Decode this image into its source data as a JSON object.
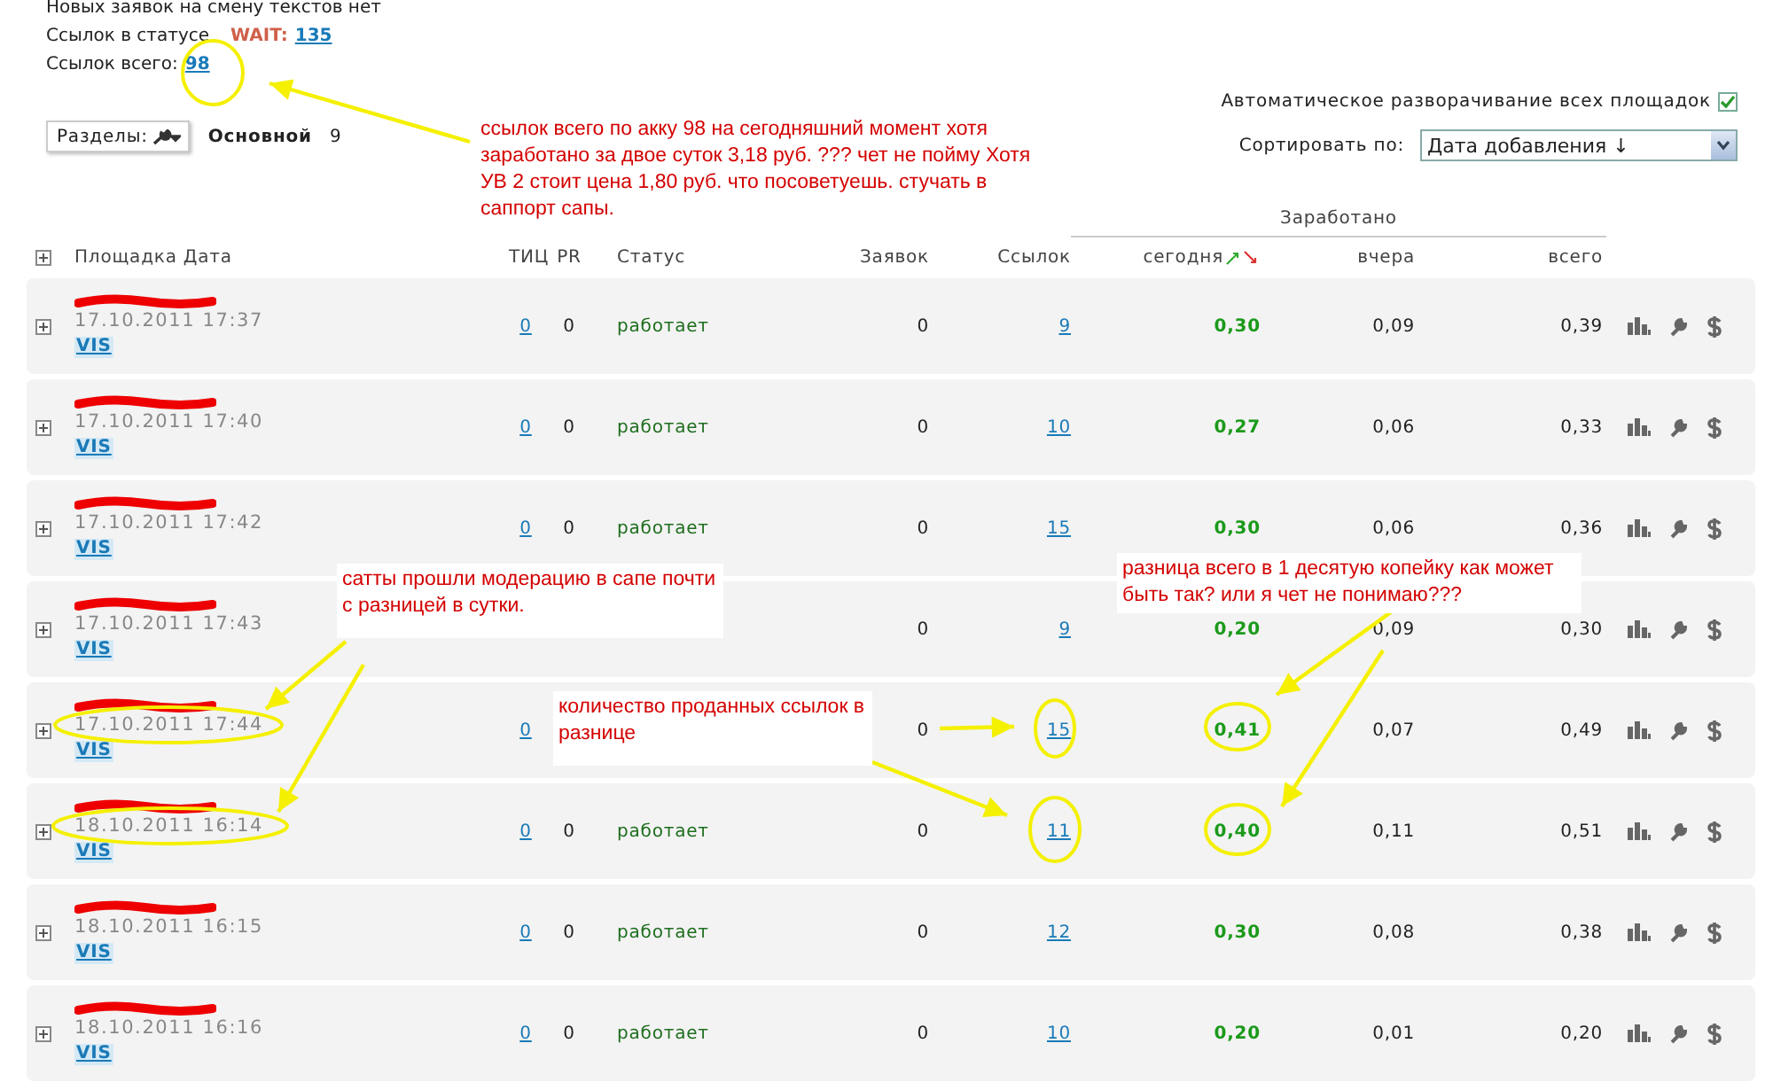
{
  "summary": {
    "no_requests_text": "Новых заявок на смену текстов нет",
    "wait_label": "Ссылок в статусе",
    "wait_status": "WAIT:",
    "wait_count": "135",
    "total_label": "Ссылок всего:",
    "total_count": "98"
  },
  "sections": {
    "label": "Разделы:",
    "current": "Основной",
    "count": "9"
  },
  "auto_expand": {
    "label": "Автоматическое разворачивание всех площадок",
    "checked": true
  },
  "sort": {
    "label": "Сортировать по:",
    "value": "Дата добавления ↓"
  },
  "table": {
    "group_header": "Заработано",
    "columns": [
      "Площадка Дата",
      "ТИЦ",
      "PR",
      "Статус",
      "Заявок",
      "Ссылок",
      "сегодня",
      "вчера",
      "всего"
    ],
    "rows": [
      {
        "date": "17.10.2011 17:37",
        "tag": "VIS",
        "tic": "0",
        "pr": "0",
        "status": "работает",
        "requests": "0",
        "links": "9",
        "today": "0,30",
        "yesterday": "0,09",
        "total": "0,39"
      },
      {
        "date": "17.10.2011 17:40",
        "tag": "VIS",
        "tic": "0",
        "pr": "0",
        "status": "работает",
        "requests": "0",
        "links": "10",
        "today": "0,27",
        "yesterday": "0,06",
        "total": "0,33"
      },
      {
        "date": "17.10.2011 17:42",
        "tag": "VIS",
        "tic": "0",
        "pr": "0",
        "status": "работает",
        "requests": "0",
        "links": "15",
        "today": "0,30",
        "yesterday": "0,06",
        "total": "0,36"
      },
      {
        "date": "17.10.2011 17:43",
        "tag": "VIS",
        "requests": "0",
        "links": "9",
        "today": "0,20",
        "yesterday": "0,09",
        "total": "0,30"
      },
      {
        "date": "17.10.2011 17:44",
        "tag": "VIS",
        "tic": "0",
        "requests": "0",
        "links": "15",
        "today": "0,41",
        "yesterday": "0,07",
        "total": "0,49"
      },
      {
        "date": "18.10.2011 16:14",
        "tag": "VIS",
        "tic": "0",
        "pr": "0",
        "status": "работает",
        "requests": "0",
        "links": "11",
        "today": "0,40",
        "yesterday": "0,11",
        "total": "0,51"
      },
      {
        "date": "18.10.2011 16:15",
        "tag": "VIS",
        "tic": "0",
        "pr": "0",
        "status": "работает",
        "requests": "0",
        "links": "12",
        "today": "0,30",
        "yesterday": "0,08",
        "total": "0,38"
      },
      {
        "date": "18.10.2011 16:16",
        "tag": "VIS",
        "tic": "0",
        "pr": "0",
        "status": "работает",
        "requests": "0",
        "links": "10",
        "today": "0,20",
        "yesterday": "0,01",
        "total": "0,20"
      }
    ]
  },
  "annotations": [
    {
      "text": "ссылок всего по акку 98 на сегодняшний момент хотя заработано за двое суток 3,18 руб. ???  чет не пойму Хотя УВ 2 стоит цена 1,80 руб. что посоветуешь. стучать в саппорт сапы."
    },
    {
      "text": "сатты прошли модерацию в сапе почти с разницей в сутки."
    },
    {
      "text": "количество проданных ссылок в разнице"
    },
    {
      "text": "разница всего в 1 десятую копейку как может быть так? или я чет не понимаю???"
    }
  ]
}
